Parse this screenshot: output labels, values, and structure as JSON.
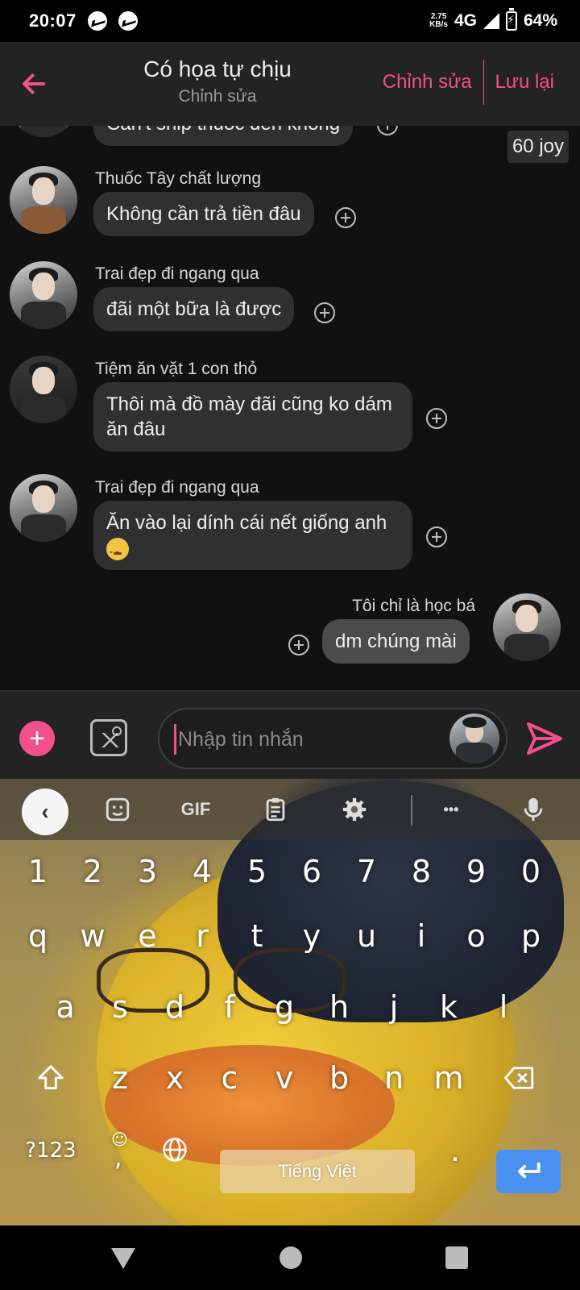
{
  "status_bar": {
    "time": "20:07",
    "speed_value": "2.75",
    "speed_unit": "KB/s",
    "network": "4G",
    "battery": "64%",
    "icons": [
      "messenger-icon",
      "messenger-icon",
      "signal-icon",
      "battery-charging-icon"
    ]
  },
  "header": {
    "title": "Có họa tự chịu",
    "subtitle": "Chỉnh sửa",
    "edit_label": "Chỉnh sửa",
    "save_label": "Lưu lại",
    "accent_color": "#f34f8a"
  },
  "messages": {
    "partial_text": "Can't ship thuốc đến không",
    "joy_badge": "60 joy",
    "items": [
      {
        "sender": "Thuốc Tây chất lượng",
        "text": "Không cần trả tiền đâu"
      },
      {
        "sender": "Trai đẹp đi ngang qua",
        "text": "đãi một bữa là được"
      },
      {
        "sender": "Tiệm ăn vặt 1 con thỏ",
        "text": "Thôi mà đồ mày đãi cũng ko dám ăn đâu"
      },
      {
        "sender": "Trai đẹp đi ngang qua",
        "text": "Ăn vào lại dính cái nết giống anh",
        "emoji": "unamused-face"
      },
      {
        "sender": "Tôi chỉ là học bá",
        "text": "dm chúng mài",
        "mine": true
      }
    ]
  },
  "composer": {
    "placeholder": "Nhập tin nhắn"
  },
  "keyboard": {
    "gif_label": "GIF",
    "more_label": "•••",
    "number_row": [
      "1",
      "2",
      "3",
      "4",
      "5",
      "6",
      "7",
      "8",
      "9",
      "0"
    ],
    "row1": [
      "q",
      "w",
      "e",
      "r",
      "t",
      "y",
      "u",
      "i",
      "o",
      "p"
    ],
    "row2": [
      "a",
      "s",
      "d",
      "f",
      "g",
      "h",
      "j",
      "k",
      "l"
    ],
    "row3": [
      "z",
      "x",
      "c",
      "v",
      "b",
      "n",
      "m"
    ],
    "symbols_label": "?123",
    "comma_label": ",",
    "period_label": ".",
    "space_label": "Tiếng Việt",
    "enter_color": "#4a90f0"
  }
}
